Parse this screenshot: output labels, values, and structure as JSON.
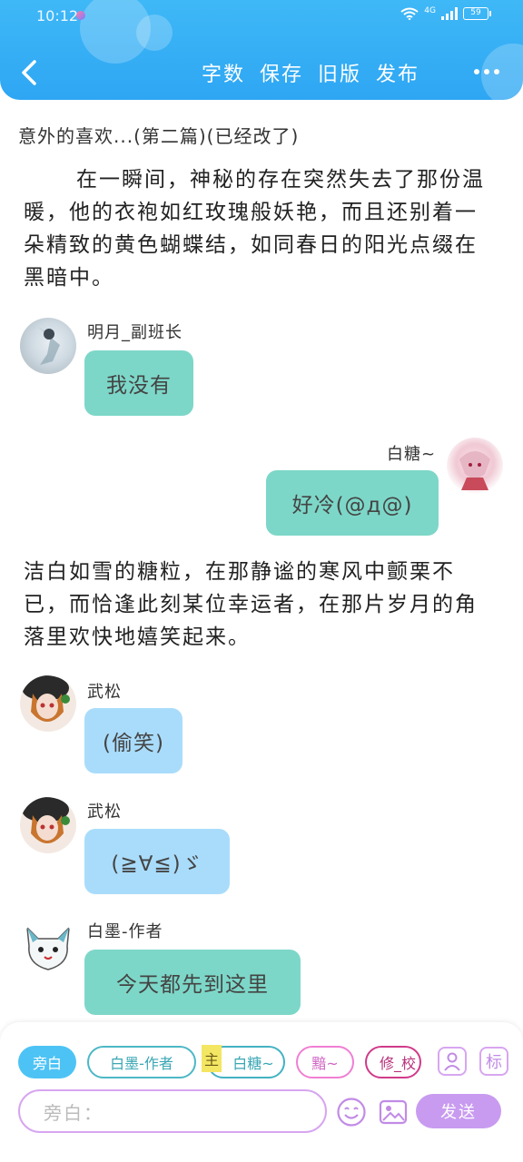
{
  "status_bar": {
    "time": "10:12",
    "network": "4G",
    "battery": "59"
  },
  "header": {
    "nav": [
      "字数",
      "保存",
      "旧版",
      "发布"
    ]
  },
  "story": {
    "title": "意外的喜欢...(第二篇)(已经改了)",
    "paragraphs": [
      "在一瞬间，神秘的存在突然失去了那份温暖，他的衣袍如红玫瑰般妖艳，而且还别着一朵精致的黄色蝴蝶结，如同春日的阳光点缀在黑暗中。",
      "洁白如雪的糖粒，在那静谧的寒风中颤栗不已，而恰逢此刻某位幸运者，在那片岁月的角落里欢快地嬉笑起来。"
    ],
    "messages": [
      {
        "user": "明月_副班长",
        "text": "我没有"
      },
      {
        "user": "白糖~",
        "text": "好冷(@д@)"
      },
      {
        "user": "武松",
        "text": "(偷笑)"
      },
      {
        "user": "武松",
        "text": "(≧∀≦)ゞ"
      },
      {
        "user": "白墨-作者",
        "text": "今天都先到这里"
      }
    ]
  },
  "composer": {
    "roles": [
      "旁白",
      "白墨-作者",
      "白糖~",
      "黯~",
      "修_校"
    ],
    "main_tag": "主",
    "icon_label_tag": "标",
    "input_placeholder": "旁白：",
    "send_label": "发送"
  },
  "colors": {
    "header": "#2ea6f3",
    "bubble_teal": "#7dd7c8",
    "bubble_blue": "#a9dcfb",
    "accent_purple": "#c89bf0"
  },
  "icons": [
    "back-arrow-icon",
    "more-icon",
    "wifi-icon",
    "signal-icon",
    "battery-icon",
    "user-card-icon",
    "emoji-icon",
    "image-icon"
  ]
}
